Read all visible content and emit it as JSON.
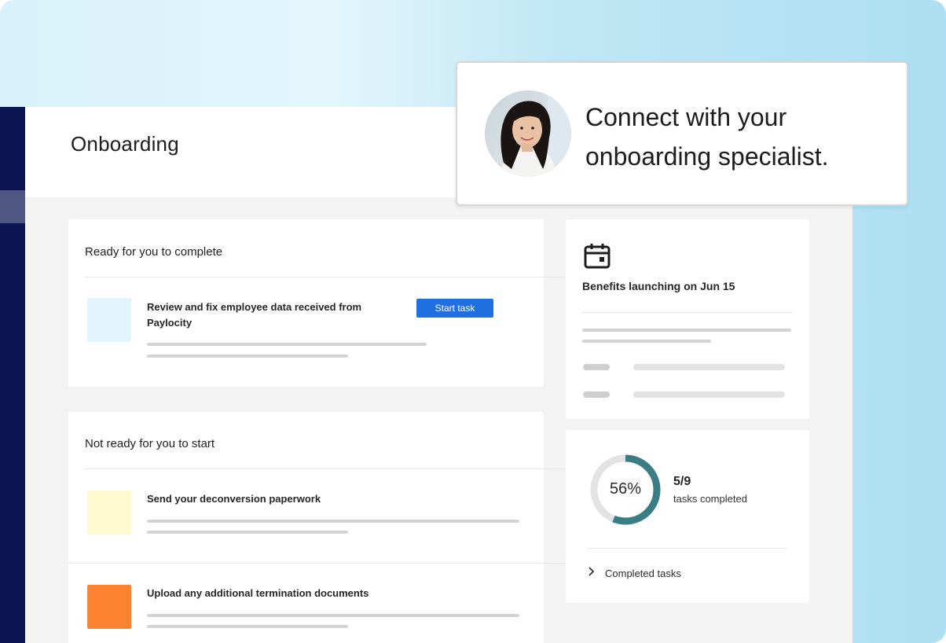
{
  "app": {
    "page_title": "Onboarding"
  },
  "popup": {
    "line1": "Connect with your",
    "line2": "onboarding specialist."
  },
  "ready_section": {
    "heading": "Ready for you to complete",
    "tasks": [
      {
        "title_line1": "Review and fix employee data received from",
        "title_line2": "Paylocity",
        "thumb_color": "#e2f5fd",
        "action_label": "Start task"
      }
    ]
  },
  "not_ready_section": {
    "heading": "Not ready for you to start",
    "tasks": [
      {
        "title": "Send your deconversion paperwork",
        "thumb_color": "#fefbd0"
      },
      {
        "title": "Upload any additional termination documents",
        "thumb_color": "#fb8230"
      }
    ]
  },
  "benefits_card": {
    "icon": "calendar-icon",
    "title": "Benefits launching on Jun 15"
  },
  "progress_card": {
    "percent_label": "56%",
    "percent_value": 0.56,
    "count_label": "5/9",
    "caption": "tasks completed",
    "completed_label": "Completed tasks",
    "ring_color": "#3a7d85",
    "track_color": "#e3e3e3"
  },
  "colors": {
    "rail": "#0b1552",
    "primary_button": "#1f6fe0"
  }
}
